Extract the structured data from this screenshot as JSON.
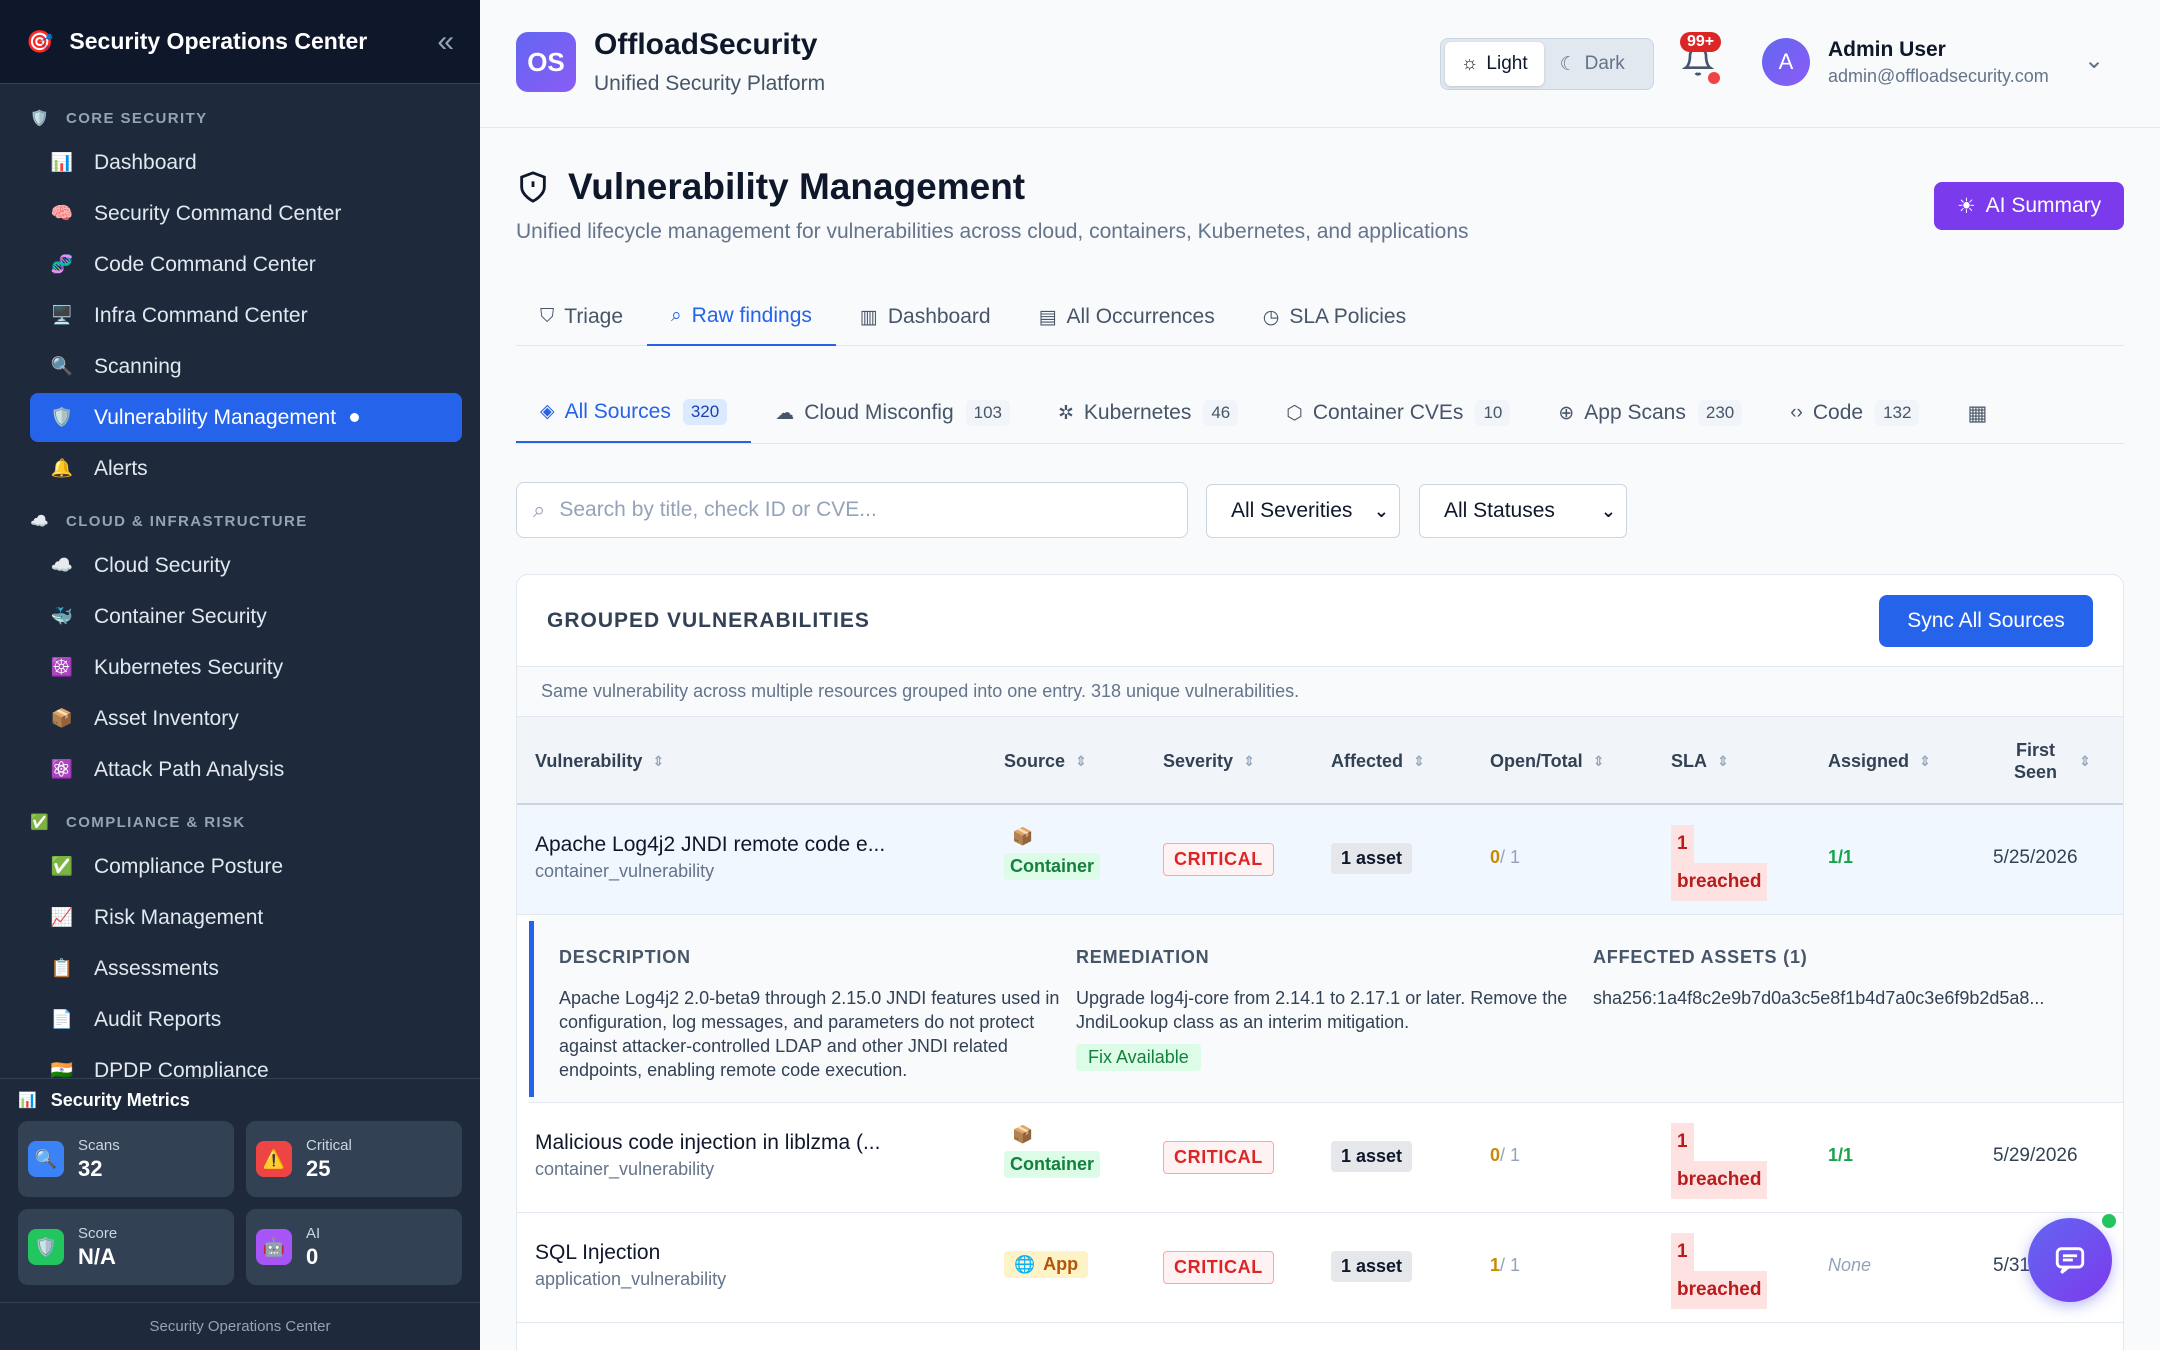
{
  "sidebar": {
    "title": "Security Operations Center",
    "sections": [
      {
        "icon": "🛡️",
        "title": "CORE SECURITY",
        "items": [
          {
            "icon": "📊",
            "label": "Dashboard"
          },
          {
            "icon": "🧠",
            "label": "Security Command Center"
          },
          {
            "icon": "🧬",
            "label": "Code Command Center"
          },
          {
            "icon": "🖥️",
            "label": "Infra Command Center"
          },
          {
            "icon": "🔍",
            "label": "Scanning"
          },
          {
            "icon": "🛡️",
            "label": "Vulnerability Management",
            "active": true
          },
          {
            "icon": "🔔",
            "label": "Alerts"
          }
        ]
      },
      {
        "icon": "☁️",
        "title": "CLOUD & INFRASTRUCTURE",
        "items": [
          {
            "icon": "☁️",
            "label": "Cloud Security"
          },
          {
            "icon": "🐳",
            "label": "Container Security"
          },
          {
            "icon": "☸️",
            "label": "Kubernetes Security"
          },
          {
            "icon": "📦",
            "label": "Asset Inventory"
          },
          {
            "icon": "⚛️",
            "label": "Attack Path Analysis"
          }
        ]
      },
      {
        "icon": "✅",
        "title": "COMPLIANCE & RISK",
        "items": [
          {
            "icon": "✅",
            "label": "Compliance Posture"
          },
          {
            "icon": "📈",
            "label": "Risk Management"
          },
          {
            "icon": "📋",
            "label": "Assessments"
          },
          {
            "icon": "📄",
            "label": "Audit Reports"
          },
          {
            "icon": "🇮🇳",
            "label": "DPDP Compliance"
          }
        ]
      }
    ],
    "metrics": {
      "title": "Security Metrics",
      "cards": [
        {
          "icon": "🔍",
          "label": "Scans",
          "value": "32",
          "color": "#3b82f6"
        },
        {
          "icon": "⚠️",
          "label": "Critical",
          "value": "25",
          "color": "#ef4444"
        },
        {
          "icon": "🛡️",
          "label": "Score",
          "value": "N/A",
          "color": "#22c55e"
        },
        {
          "icon": "🤖",
          "label": "AI",
          "value": "0",
          "color": "#a855f7"
        }
      ]
    },
    "footer": "Security Operations Center"
  },
  "topbar": {
    "logo": "OS",
    "brand": "OffloadSecurity",
    "tagline": "Unified Security Platform",
    "theme_light": "Light",
    "theme_dark": "Dark",
    "notif_count": "99+",
    "user_initial": "A",
    "user_name": "Admin User",
    "user_email": "admin@offloadsecurity.com"
  },
  "page": {
    "title": "Vulnerability Management",
    "subtitle": "Unified lifecycle management for vulnerabilities across cloud, containers, Kubernetes, and applications",
    "ai_button": "AI Summary"
  },
  "tabs": [
    {
      "icon": "shield",
      "label": "Triage"
    },
    {
      "icon": "search",
      "label": "Raw findings",
      "active": true
    },
    {
      "icon": "chart",
      "label": "Dashboard"
    },
    {
      "icon": "clipboard",
      "label": "All Occurrences"
    },
    {
      "icon": "timer",
      "label": "SLA Policies"
    }
  ],
  "source_tabs": [
    {
      "icon": "layers",
      "label": "All Sources",
      "count": "320",
      "active": true
    },
    {
      "icon": "cloud",
      "label": "Cloud Misconfig",
      "count": "103"
    },
    {
      "icon": "kube",
      "label": "Kubernetes",
      "count": "46"
    },
    {
      "icon": "box",
      "label": "Container CVEs",
      "count": "10"
    },
    {
      "icon": "globe",
      "label": "App Scans",
      "count": "230"
    },
    {
      "icon": "code",
      "label": "Code",
      "count": "132"
    }
  ],
  "filters": {
    "search_placeholder": "Search by title, check ID or CVE...",
    "severity": "All Severities",
    "status": "All Statuses"
  },
  "grouped": {
    "title": "GROUPED VULNERABILITIES",
    "sync_button": "Sync All Sources",
    "note": "Same vulnerability across multiple resources grouped into one entry. 318 unique vulnerabilities.",
    "columns": {
      "vulnerability": "Vulnerability",
      "source": "Source",
      "severity": "Severity",
      "affected": "Affected",
      "open_total": "Open/Total",
      "sla": "SLA",
      "assigned": "Assigned",
      "first_seen_1": "First",
      "first_seen_2": "Seen"
    },
    "rows": [
      {
        "name": "Apache Log4j2 JNDI remote code e...",
        "type": "container_vulnerability",
        "source_icon": "📦",
        "source": "Container",
        "severity": "CRITICAL",
        "affected": "1 asset",
        "open": "0",
        "total": "/ 1",
        "sla_count": "1",
        "sla_label": "breached",
        "assigned": "1/1",
        "first_seen": "5/25/2026"
      },
      {
        "name": "Malicious code injection in liblzma (...",
        "type": "container_vulnerability",
        "source_icon": "📦",
        "source": "Container",
        "severity": "CRITICAL",
        "affected": "1 asset",
        "open": "0",
        "total": "/ 1",
        "sla_count": "1",
        "sla_label": "breached",
        "assigned": "1/1",
        "first_seen": "5/29/2026"
      },
      {
        "name": "SQL Injection",
        "type": "application_vulnerability",
        "source_icon": "🌐",
        "source": "App",
        "severity": "CRITICAL",
        "affected": "1 asset",
        "open": "1",
        "total": "/ 1",
        "sla_count": "1",
        "sla_label": "breached",
        "assigned": "None",
        "first_seen": "5/31/"
      }
    ],
    "detail": {
      "description_label": "DESCRIPTION",
      "description": "Apache Log4j2 2.0-beta9 through 2.15.0 JNDI features used in configuration, log messages, and parameters do not protect against attacker-controlled LDAP and other JNDI related endpoints, enabling remote code execution.",
      "remediation_label": "REMEDIATION",
      "remediation": "Upgrade log4j-core from 2.14.1 to 2.17.1 or later. Remove the JndiLookup class as an interim mitigation.",
      "fix_badge": "Fix Available",
      "assets_label": "AFFECTED ASSETS (1)",
      "asset": "sha256:1a4f8c2e9b7d0a3c5e8f1b4d7a0c3e6f9b2d5a8..."
    }
  }
}
